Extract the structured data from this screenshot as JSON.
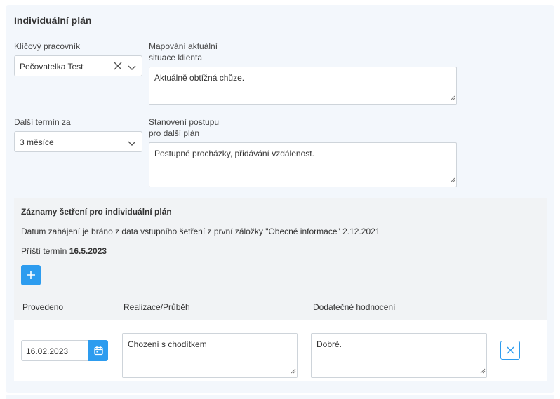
{
  "section": {
    "title": "Individuální plán"
  },
  "fields": {
    "key_worker": {
      "label": "Klíčový pracovník",
      "value": "Pečovatelka Test"
    },
    "mapping": {
      "label_line1": "Mapování aktuální",
      "label_line2": "situace klienta",
      "value": "Aktuálně obtížná chůze."
    },
    "next_term": {
      "label": "Další termín za",
      "value": "3 měsíce"
    },
    "procedure": {
      "label_line1": "Stanovení postupu",
      "label_line2": "pro další plán",
      "value": "Postupné procházky, přidávání vzdálenost."
    }
  },
  "records": {
    "title": "Záznamy šetření pro individuální plán",
    "info": "Datum zahájení je bráno z data vstupního šetření z první záložky \"Obecné informace\" 2.12.2021",
    "next_label": "Příští termín",
    "next_date": "16.5.2023",
    "add_button_icon": "plus-icon",
    "columns": [
      "Provedeno",
      "Realizace/Průběh",
      "Dodatečné hodnocení"
    ],
    "rows": [
      {
        "date": "16.02.2023",
        "realization": "Chození s chodítkem",
        "evaluation": "Dobré."
      }
    ]
  },
  "colors": {
    "accent": "#2d9cef",
    "panel_bg": "#f3f7fc",
    "records_bg": "#f1f3f5"
  }
}
